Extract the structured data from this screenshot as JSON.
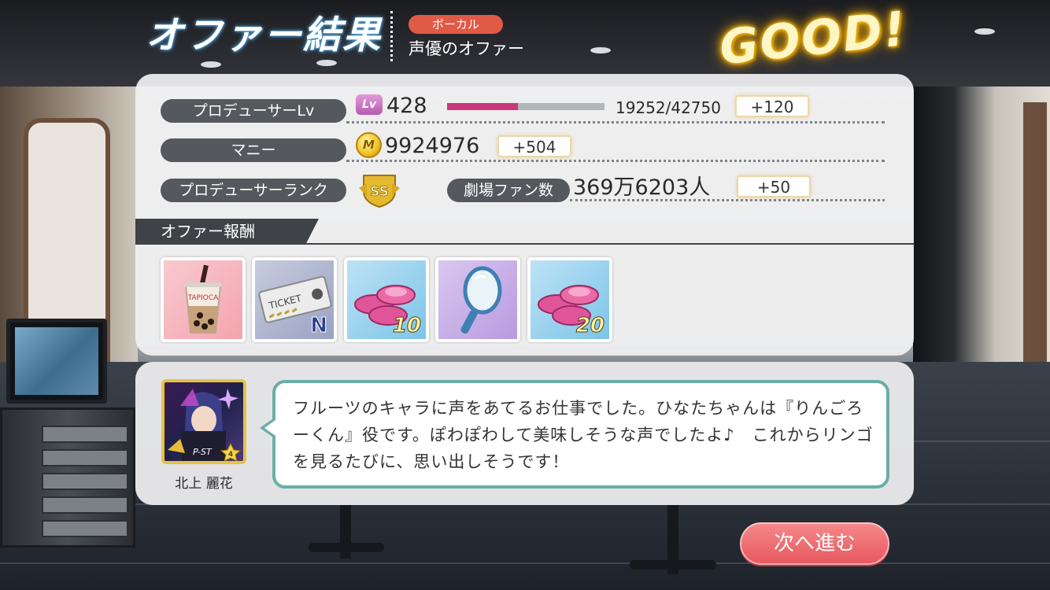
{
  "header": {
    "title": "オファー結果",
    "category_badge": "ボーカル",
    "offer_name": "声優のオファー",
    "result_rank": "GOOD!"
  },
  "stats": {
    "producer_lv_label": "プロデューサーLv",
    "lv_icon": "Lv",
    "level": "428",
    "exp_text": "19252/42750",
    "exp_progress": 0.45,
    "exp_gain": "+120",
    "money_label": "マニー",
    "money_icon": "M",
    "money": "9924976",
    "money_gain": "+504",
    "rank_label": "プロデューサーランク",
    "rank_icon": "SS",
    "fans_label": "劇場ファン数",
    "fans": "369万6203人",
    "fans_gain": "+50"
  },
  "rewards": {
    "section_title": "オファー報酬",
    "items": [
      {
        "icon": "tapioca-drink-icon",
        "cup_text": "TAPIOCA",
        "qty": ""
      },
      {
        "icon": "ticket-icon",
        "ticket_text": "TICKET",
        "grade": "N"
      },
      {
        "icon": "pink-coins-icon",
        "qty": "10"
      },
      {
        "icon": "hand-mirror-icon",
        "qty": ""
      },
      {
        "icon": "pink-coins-icon",
        "qty": "20"
      }
    ]
  },
  "dialog": {
    "card_type": "P-ST",
    "card_rank": "4",
    "character_name": "北上 麗花",
    "message": "フルーツのキャラに声をあてるお仕事でした。ひなたちゃんは『りんごろーくん』役です。ぽわぽわして美味しそうな声でしたよ♪　これからリンゴを見るたびに、思い出しそうです！"
  },
  "buttons": {
    "next": "次へ進む"
  },
  "colors": {
    "accent_pink": "#c93a79",
    "badge_red": "#e05a46",
    "button_coral": "#e6575f",
    "bubble_border": "#6aaea6",
    "good_gold": "#ffcf33"
  }
}
